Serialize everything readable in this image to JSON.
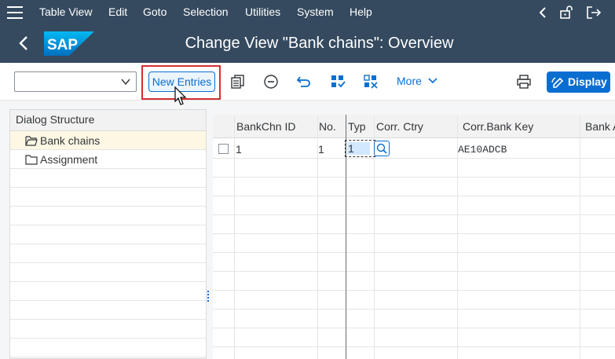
{
  "menu": {
    "items": [
      "Table View",
      "Edit",
      "Goto",
      "Selection",
      "Utilities",
      "System",
      "Help"
    ]
  },
  "title": "Change View \"Bank chains\": Overview",
  "toolbar": {
    "new_entries": "New Entries",
    "more": "More",
    "display": "Display"
  },
  "dialog_structure": {
    "header": "Dialog Structure",
    "items": [
      "Bank chains",
      "Assignment"
    ]
  },
  "table": {
    "columns": [
      "BankChn ID",
      "No.",
      "Typ",
      "Corr. Ctry",
      "Corr.Bank Key",
      "Bank A"
    ],
    "rows": [
      {
        "bankchn_id": "1",
        "no": "1",
        "typ": "1",
        "corr_ctry": "",
        "corr_bank_key": "AE10ADCB",
        "bank_a": ""
      }
    ]
  },
  "colors": {
    "shell": "#354a5f",
    "accent": "#0a6ed1",
    "highlight_frame": "#d32f2f"
  }
}
